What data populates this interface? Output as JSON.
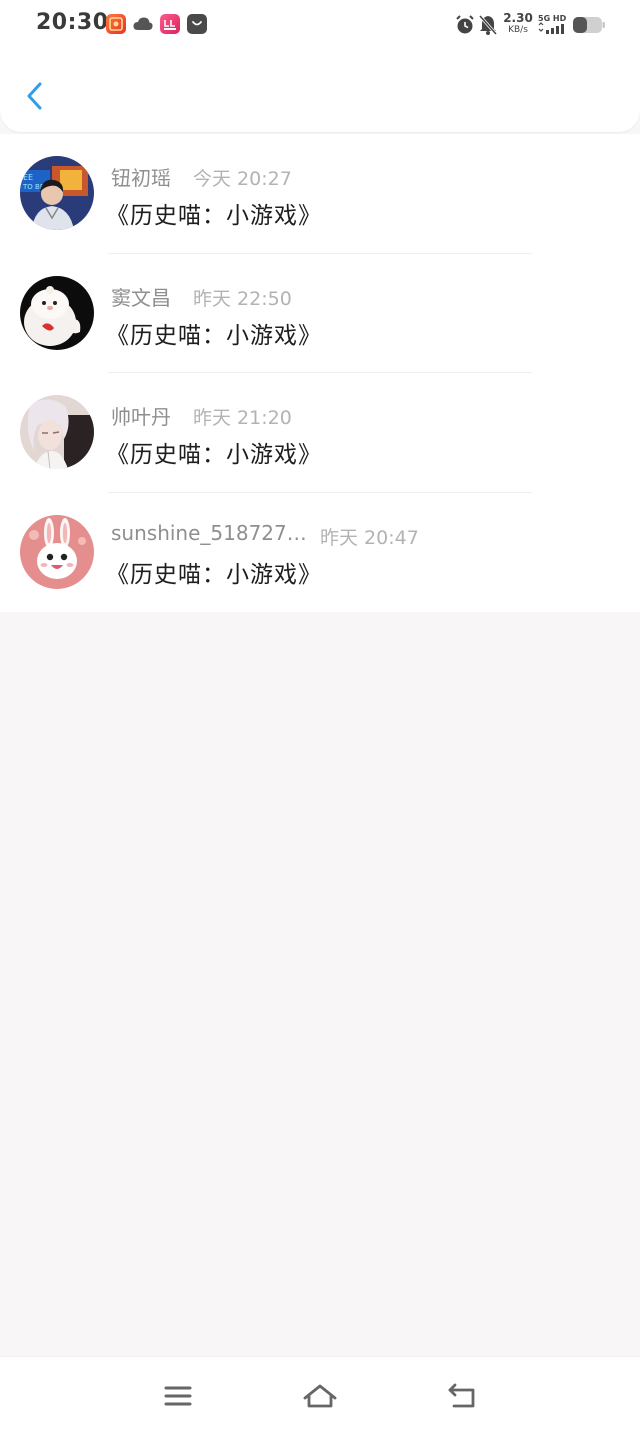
{
  "status_bar": {
    "time": "20:30",
    "net_speed_value": "2.30",
    "net_speed_unit": "KB/s",
    "network": "5G HD",
    "icons": [
      "app-icon-red",
      "cloud-icon",
      "app-icon-pink",
      "bag-icon",
      "alarm-icon",
      "bell-muted-icon",
      "signal-icon",
      "battery-icon"
    ]
  },
  "header": {
    "back_icon": "chevron-left-icon",
    "accent_color": "#2e9ee6"
  },
  "messages": [
    {
      "name": "钮初瑶",
      "time": "今天 20:27",
      "text": "《历史喵：小游戏》",
      "avatar": "avatar-boy-neon"
    },
    {
      "name": "窦文昌",
      "time": "昨天 22:50",
      "text": "《历史喵：小游戏》",
      "avatar": "avatar-white-plush"
    },
    {
      "name": "帅叶丹",
      "time": "昨天 21:20",
      "text": "《历史喵：小游戏》",
      "avatar": "avatar-anime-girl"
    },
    {
      "name": "sunshine_518727…",
      "time": "昨天 20:47",
      "text": "《历史喵：小游戏》",
      "avatar": "avatar-bunny"
    }
  ],
  "nav_bar": {
    "icons": [
      "menu-icon",
      "home-icon",
      "back-icon"
    ]
  }
}
